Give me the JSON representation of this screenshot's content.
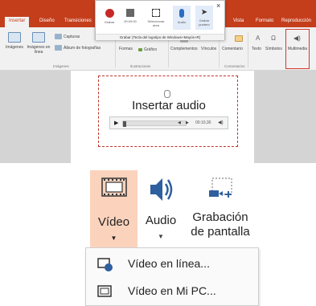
{
  "ribbon": {
    "tabs": [
      "Insertar",
      "Diseño",
      "Transiciones",
      "Vista",
      "Formato",
      "Reproducción"
    ],
    "buttons": {
      "imagenes": "Imágenes",
      "imagenes_linea": "Imágenes en línea",
      "capturas": "Capturas",
      "album": "Álbum de fotografías",
      "formas": "Formas",
      "grafico": "Gráfico",
      "complementos": "Complementos",
      "vinculos": "Vínculos",
      "comentario": "Comentario",
      "texto": "Texto",
      "simbolos": "Símbolos",
      "multimedia": "Multimedia"
    },
    "groups": {
      "imagenes": "Imágenes",
      "ilustraciones": "Ilustraciones",
      "comentarios": "Comentarios"
    }
  },
  "recorder": {
    "grabar": "Grabar",
    "time": "00:00:00",
    "seleccionar": "Seleccionar área",
    "audio": "Audio",
    "grabar_puntero": "Grabar puntero",
    "close": "×",
    "hint": "Grabar (Tecla del logotipo de Windows+Mayús+R)"
  },
  "slide": {
    "title": "Insertar audio",
    "player_time": "00:10,30"
  },
  "multimedia": {
    "video": "Vídeo",
    "audio": "Audio",
    "grabacion": "Grabación",
    "de_pantalla": "de pantalla",
    "menu": [
      "Vídeo en línea...",
      "Vídeo en Mi PC..."
    ]
  },
  "colors": {
    "accent": "#c43e1c",
    "highlight": "#fbd3bd",
    "selection": "#c0322a",
    "mic": "#2b6cc4"
  }
}
